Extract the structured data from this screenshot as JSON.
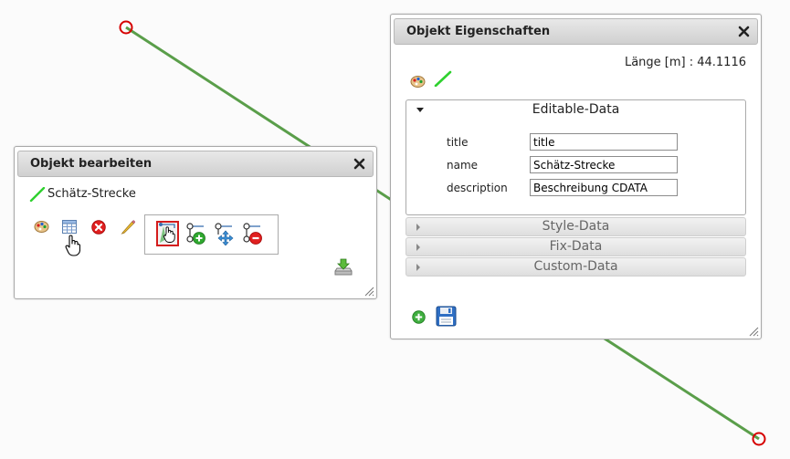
{
  "edit_dialog": {
    "title": "Objekt bearbeiten",
    "object_name": "Schätz-Strecke",
    "icons": [
      "palette-icon",
      "table-icon",
      "delete-icon",
      "pencil-icon",
      "select-vertex-icon",
      "add-vertex-icon",
      "move-vertex-icon",
      "remove-vertex-icon",
      "download-icon"
    ]
  },
  "props_dialog": {
    "title": "Objekt Eigenschaften",
    "length_label": "Länge [m] : 44.1116",
    "sections": {
      "editable": "Editable-Data",
      "style": "Style-Data",
      "fix": "Fix-Data",
      "custom": "Custom-Data"
    },
    "fields": [
      {
        "label": "title",
        "value": "title"
      },
      {
        "label": "name",
        "value": "Schätz-Strecke"
      },
      {
        "label": "description",
        "value": "Beschreibung CDATA"
      }
    ]
  },
  "colors": {
    "line": "#5a9e4a",
    "vertex_marker": "#d60000",
    "line_icon": "#2fd12f"
  }
}
